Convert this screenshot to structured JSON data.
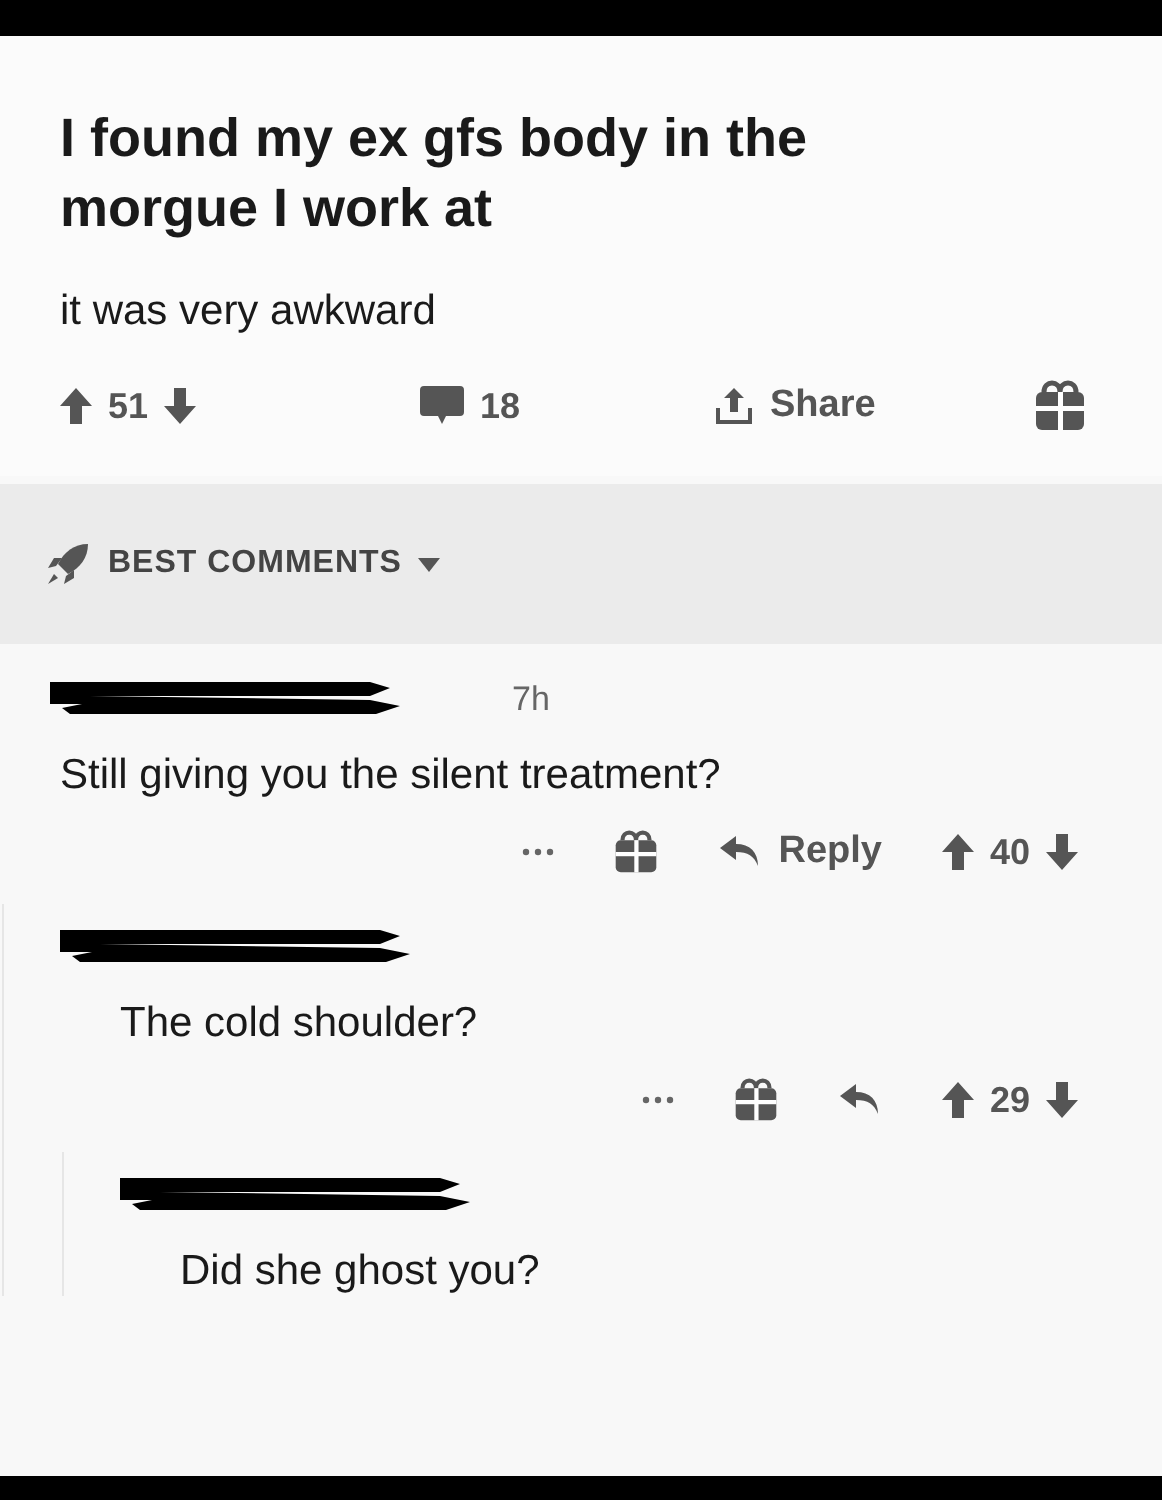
{
  "post": {
    "title": "I found my ex gfs body in the morgue I work at",
    "body": "it was very awkward",
    "score": "51",
    "comments": "18",
    "share": "Share"
  },
  "sort": {
    "label": "BEST COMMENTS"
  },
  "comments": [
    {
      "time": "7h",
      "text": "Still giving you the silent treatment?",
      "reply_label": "Reply",
      "score": "40",
      "children": [
        {
          "text": "The cold shoulder?",
          "score": "29",
          "children": [
            {
              "text": "Did she ghost you?"
            }
          ]
        }
      ]
    }
  ]
}
